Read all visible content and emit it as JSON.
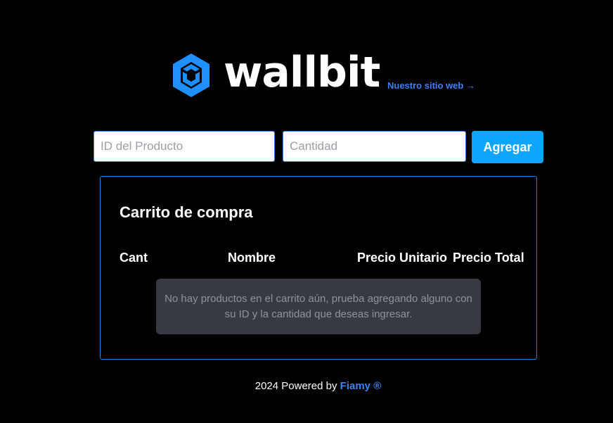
{
  "header": {
    "logo_text": "wallbit",
    "site_link": "Nuestro sitio web →"
  },
  "form": {
    "product_id_placeholder": "ID del Producto",
    "quantity_placeholder": "Cantidad",
    "add_button": "Agregar"
  },
  "cart": {
    "title": "Carrito de compra",
    "columns": [
      "Cant",
      "Nombre",
      "Precio Unitario",
      "Precio Total"
    ],
    "empty_message": "No hay productos en el carrito aún, prueba agregando alguno con su ID y la cantidad que deseas ingresar."
  },
  "footer": {
    "prefix": "2024 Powered by",
    "brand": "Fiamy",
    "mark": "®"
  },
  "colors": {
    "background": "#000000",
    "accent": "#3b82f6",
    "button": "#0ea5ff",
    "logo_mark": "#1e90ff",
    "panel_border": "#1d7fd6",
    "empty_box": "#373a40"
  },
  "icons": {
    "logo": "wallbit-logo-icon"
  }
}
